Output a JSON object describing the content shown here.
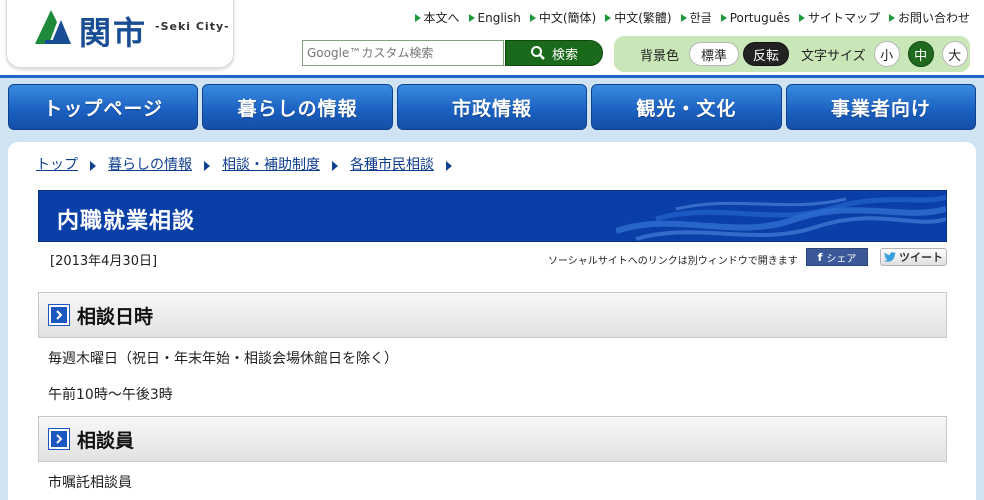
{
  "logo": {
    "kanji": "関市",
    "roman": "-Seki City-"
  },
  "toplinks": [
    "本文へ",
    "English",
    "中文(簡体)",
    "中文(繁體)",
    "한글",
    "Português",
    "サイトマップ",
    "お問い合わせ"
  ],
  "search": {
    "placeholder": "Google™カスタム検索",
    "button": "検索"
  },
  "accessibility": {
    "bg_label": "背景色",
    "bg_standard": "標準",
    "bg_invert": "反転",
    "text_label": "文字サイズ",
    "size_small": "小",
    "size_medium": "中",
    "size_large": "大"
  },
  "nav": [
    "トップページ",
    "暮らしの情報",
    "市政情報",
    "観光・文化",
    "事業者向け"
  ],
  "breadcrumb": [
    "トップ",
    "暮らしの情報",
    "相談・補助制度",
    "各種市民相談"
  ],
  "page": {
    "title": "内職就業相談",
    "date": "[2013年4月30日]",
    "social_note": "ソーシャルサイトへのリンクは別ウィンドウで開きます",
    "share": "シェア",
    "tweet": "ツイート"
  },
  "sections": [
    {
      "title": "相談日時",
      "lines": [
        "毎週木曜日（祝日・年末年始・相談会場休館日を除く）",
        "午前10時～午後3時"
      ]
    },
    {
      "title": "相談員",
      "lines": [
        "市嘱託相談員"
      ]
    }
  ],
  "colors": {
    "nav_blue": "#1a5fc0",
    "title_blue": "#0a3fa8",
    "accent_green": "#1b6a1b"
  }
}
